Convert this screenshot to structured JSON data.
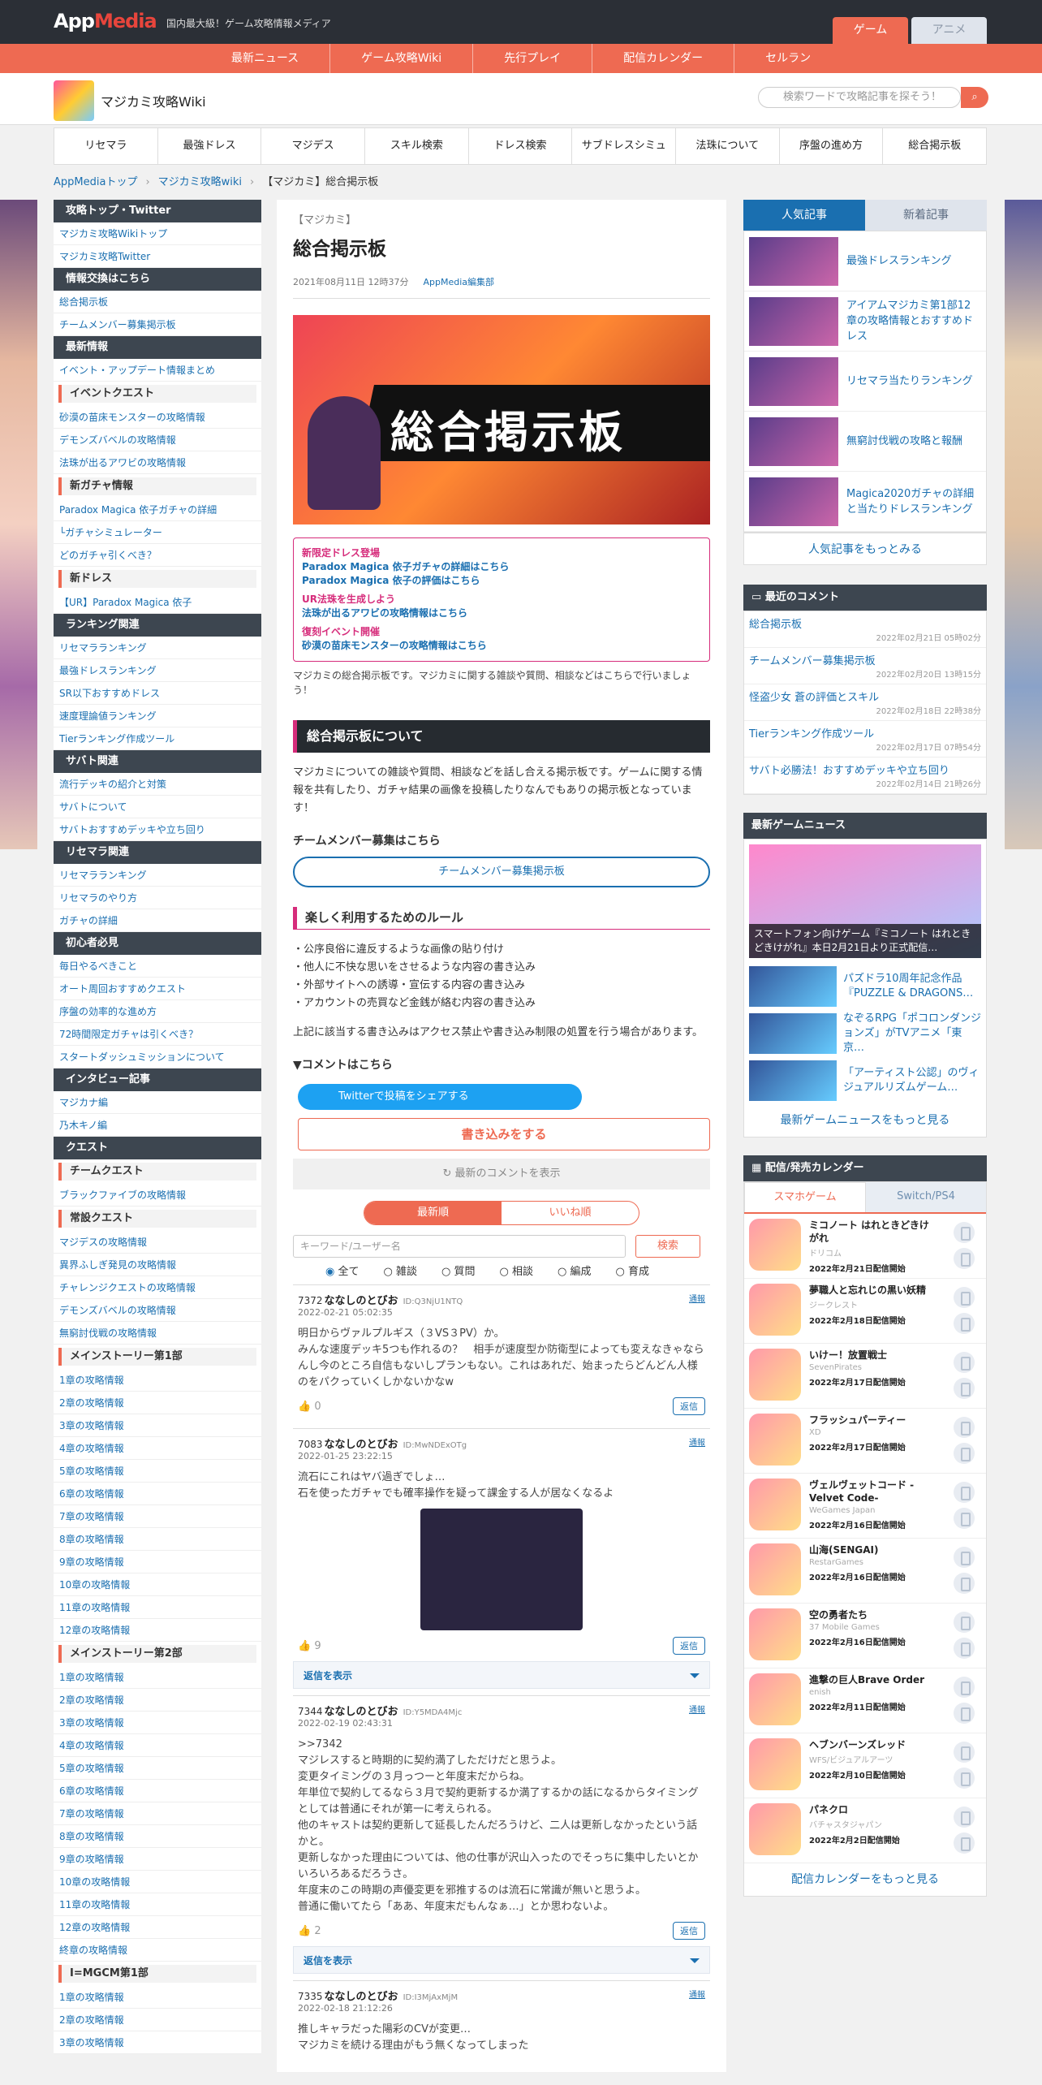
{
  "topbar": {
    "logo_a": "App",
    "logo_b": "Media",
    "tagline": "国内最大級！ゲーム攻略情報メディア",
    "tab_game": "ゲーム",
    "tab_anime": "アニメ"
  },
  "rednav": [
    "最新ニュース",
    "ゲーム攻略Wiki",
    "先行プレイ",
    "配信カレンダー",
    "セルラン"
  ],
  "site": {
    "name": "マジカミ攻略Wiki",
    "search_placeholder": "検索ワードで攻略記事を探そう！"
  },
  "menu": [
    "リセマラ",
    "最強ドレス",
    "マジデス",
    "スキル検索",
    "ドレス検索",
    "サブドレスシミュ",
    "法珠について",
    "序盤の進め方",
    "総合掲示板"
  ],
  "breadcrumb": [
    "AppMediaトップ",
    "マジカミ攻略wiki",
    "【マジカミ】総合掲示板"
  ],
  "sidebar": [
    {
      "type": "h",
      "t": "攻略トップ・Twitter"
    },
    {
      "type": "l",
      "t": "マジカミ攻略Wikiトップ"
    },
    {
      "type": "l",
      "t": "マジカミ攻略Twitter"
    },
    {
      "type": "h",
      "t": "情報交換はこちら"
    },
    {
      "type": "l",
      "t": "総合掲示板"
    },
    {
      "type": "l",
      "t": "チームメンバー募集掲示板"
    },
    {
      "type": "h",
      "t": "最新情報"
    },
    {
      "type": "l",
      "t": "イベント・アップデート情報まとめ"
    },
    {
      "type": "s",
      "t": "イベントクエスト"
    },
    {
      "type": "l",
      "t": "砂漠の苗床モンスターの攻略情報"
    },
    {
      "type": "l",
      "t": "デモンズバベルの攻略情報"
    },
    {
      "type": "l",
      "t": "法珠が出るアワビの攻略情報"
    },
    {
      "type": "s",
      "t": "新ガチャ情報"
    },
    {
      "type": "l",
      "t": "Paradox Magica 依子ガチャの詳細"
    },
    {
      "type": "l",
      "t": "└ガチャシミュレーター"
    },
    {
      "type": "l",
      "t": "どのガチャ引くべき？"
    },
    {
      "type": "s",
      "t": "新ドレス"
    },
    {
      "type": "l",
      "t": "【UR】Paradox Magica 依子"
    },
    {
      "type": "h",
      "t": "ランキング関連"
    },
    {
      "type": "l",
      "t": "リセマラランキング"
    },
    {
      "type": "l",
      "t": "最強ドレスランキング"
    },
    {
      "type": "l",
      "t": "SR以下おすすめドレス"
    },
    {
      "type": "l",
      "t": "速度理論値ランキング"
    },
    {
      "type": "l",
      "t": "Tierランキング作成ツール"
    },
    {
      "type": "h",
      "t": "サバト関連"
    },
    {
      "type": "l",
      "t": "流行デッキの紹介と対策"
    },
    {
      "type": "l",
      "t": "サバトについて"
    },
    {
      "type": "l",
      "t": "サバトおすすめデッキや立ち回り"
    },
    {
      "type": "h",
      "t": "リセマラ関連"
    },
    {
      "type": "l",
      "t": "リセマラランキング"
    },
    {
      "type": "l",
      "t": "リセマラのやり方"
    },
    {
      "type": "l",
      "t": "ガチャの詳細"
    },
    {
      "type": "h",
      "t": "初心者必見"
    },
    {
      "type": "l",
      "t": "毎日やるべきこと"
    },
    {
      "type": "l",
      "t": "オート周回おすすめクエスト"
    },
    {
      "type": "l",
      "t": "序盤の効率的な進め方"
    },
    {
      "type": "l",
      "t": "72時間限定ガチャは引くべき？"
    },
    {
      "type": "l",
      "t": "スタートダッシュミッションについて"
    },
    {
      "type": "h",
      "t": "インタビュー記事"
    },
    {
      "type": "l",
      "t": "マジカナ編"
    },
    {
      "type": "l",
      "t": "乃木キノ編"
    },
    {
      "type": "h",
      "t": "クエスト"
    },
    {
      "type": "s",
      "t": "チームクエスト"
    },
    {
      "type": "l",
      "t": "ブラックファイブの攻略情報"
    },
    {
      "type": "s",
      "t": "常設クエスト"
    },
    {
      "type": "l",
      "t": "マジデスの攻略情報"
    },
    {
      "type": "l",
      "t": "異界ふしぎ発見の攻略情報"
    },
    {
      "type": "l",
      "t": "チャレンジクエストの攻略情報"
    },
    {
      "type": "l",
      "t": "デモンズバベルの攻略情報"
    },
    {
      "type": "l",
      "t": "無窮討伐戦の攻略情報"
    },
    {
      "type": "s",
      "t": "メインストーリー第1部"
    },
    {
      "type": "l",
      "t": "1章の攻略情報"
    },
    {
      "type": "l",
      "t": "2章の攻略情報"
    },
    {
      "type": "l",
      "t": "3章の攻略情報"
    },
    {
      "type": "l",
      "t": "4章の攻略情報"
    },
    {
      "type": "l",
      "t": "5章の攻略情報"
    },
    {
      "type": "l",
      "t": "6章の攻略情報"
    },
    {
      "type": "l",
      "t": "7章の攻略情報"
    },
    {
      "type": "l",
      "t": "8章の攻略情報"
    },
    {
      "type": "l",
      "t": "9章の攻略情報"
    },
    {
      "type": "l",
      "t": "10章の攻略情報"
    },
    {
      "type": "l",
      "t": "11章の攻略情報"
    },
    {
      "type": "l",
      "t": "12章の攻略情報"
    },
    {
      "type": "s",
      "t": "メインストーリー第2部"
    },
    {
      "type": "l",
      "t": "1章の攻略情報"
    },
    {
      "type": "l",
      "t": "2章の攻略情報"
    },
    {
      "type": "l",
      "t": "3章の攻略情報"
    },
    {
      "type": "l",
      "t": "4章の攻略情報"
    },
    {
      "type": "l",
      "t": "5章の攻略情報"
    },
    {
      "type": "l",
      "t": "6章の攻略情報"
    },
    {
      "type": "l",
      "t": "7章の攻略情報"
    },
    {
      "type": "l",
      "t": "8章の攻略情報"
    },
    {
      "type": "l",
      "t": "9章の攻略情報"
    },
    {
      "type": "l",
      "t": "10章の攻略情報"
    },
    {
      "type": "l",
      "t": "11章の攻略情報"
    },
    {
      "type": "l",
      "t": "12章の攻略情報"
    },
    {
      "type": "l",
      "t": "終章の攻略情報"
    },
    {
      "type": "s",
      "t": "I=MGCM第1部"
    },
    {
      "type": "l",
      "t": "1章の攻略情報"
    },
    {
      "type": "l",
      "t": "2章の攻略情報"
    },
    {
      "type": "l",
      "t": "3章の攻略情報"
    }
  ],
  "article": {
    "category": "【マジカミ】",
    "title": "総合掲示板",
    "date": "2021年08月11日 12時37分",
    "author": "AppMedia編集部",
    "hero_text": "総合掲示板",
    "box": [
      {
        "k": "h",
        "t": "新限定ドレス登場"
      },
      {
        "k": "l",
        "t": "Paradox Magica 依子ガチャの詳細はこちら"
      },
      {
        "k": "l",
        "t": "Paradox Magica 依子の評価はこちら"
      },
      {
        "k": "h",
        "t": "UR法珠を生成しよう"
      },
      {
        "k": "l",
        "t": "法珠が出るアワビの攻略情報はこちら"
      },
      {
        "k": "h",
        "t": "復刻イベント開催"
      },
      {
        "k": "l",
        "t": "砂漠の苗床モンスターの攻略情報はこちら"
      }
    ],
    "intro": "マジカミの総合掲示板です。マジカミに関する雑談や質問、相談などはこちらで行いましょう！",
    "h2": "総合掲示板について",
    "about": "マジカミについての雑談や質問、相談などを話し合える掲示板です。ゲームに関する情報を共有したり、ガチャ結果の画像を投稿したりなんでもありの掲示板となっています！",
    "team_heading": "チームメンバー募集はこちら",
    "team_button": "チームメンバー募集掲示板",
    "rules_heading": "楽しく利用するためのルール",
    "rules": [
      "・公序良俗に違反するような画像の貼り付け",
      "・他人に不快な思いをさせるような内容の書き込み",
      "・外部サイトへの誘導・宣伝する内容の書き込み",
      "・アカウントの売買など金銭が絡む内容の書き込み"
    ],
    "rules_note": "上記に該当する書き込みはアクセス禁止や書き込み制限の処置を行う場合があります。",
    "comment_heading": "▼コメントはこちら",
    "twitter": "Twitterで投稿をシェアする",
    "post": "書き込みをする",
    "latest": "最新のコメントを表示",
    "sort": [
      "最新順",
      "いいね順"
    ],
    "kw_placeholder": "キーワード/ユーザー名",
    "kw_btn": "検索",
    "radios": [
      "全て",
      "雑談",
      "質問",
      "相談",
      "編成",
      "育成"
    ],
    "report": "通報",
    "reply": "返信",
    "showreply": "返信を表示",
    "comments": [
      {
        "no": "7372",
        "name": "ななしのとびお",
        "id": "ID:Q3NjU1NTQ",
        "date": "2022-02-21 05:02:35",
        "text": "明日からヴァルプルギス（３VS３PV）か。\nみんな速度デッキ5つも作れるの？　相手が速度型か防衛型によっても変えなきゃならんし今のところ自信もないしプランもない。これはあれだ、始まったらどんどん人様のをパクっていくしかないかなw",
        "likes": "0"
      },
      {
        "no": "7083",
        "name": "ななしのとびお",
        "id": "ID:MwNDExOTg",
        "date": "2022-01-25 23:22:15",
        "text": "流石にこれはヤバ過ぎでしょ…\n石を使ったガチャでも確率操作を疑って課金する人が居なくなるよ",
        "likes": "9"
      },
      {
        "no": "7344",
        "name": "ななしのとびお",
        "id": "ID:Y5MDA4Mjc",
        "date": "2022-02-19 02:43:31",
        "text": ">>7342\nマジレスすると時期的に契約満了しただけだと思うよ。\n変更タイミングの３月っつーと年度末だからね。\n年単位で契約してるなら３月で契約更新するか満了するかの話になるからタイミングとしては普通にそれが第一に考えられる。\n他のキャストは契約更新して延長したんだろうけど、二人は更新しなかったという話かと。\n更新しなかった理由については、他の仕事が沢山入ったのでそっちに集中したいとかいろいろあるだろうさ。\n年度末のこの時期の声優変更を邪推するのは流石に常識が無いと思うよ。\n普通に働いてたら「ああ、年度末だもんなぁ…」とか思わないよ。",
        "likes": "2"
      },
      {
        "no": "7335",
        "name": "ななしのとびお",
        "id": "ID:I3MjAxMjM",
        "date": "2022-02-18 21:12:26",
        "text": "推しキャラだった陽彩のCVが変更…\nマジカミを続ける理由がもう無くなってしまった",
        "likes": ""
      }
    ]
  },
  "right": {
    "tabs": [
      "人気記事",
      "新着記事"
    ],
    "popular": [
      "最強ドレスランキング",
      "アイアムマジカミ第1部12章の攻略情報とおすすめドレス",
      "リセマラ当たりランキング",
      "無窮討伐戦の攻略と報酬",
      "Magica2020ガチャの詳細と当たりドレスランキング"
    ],
    "popular_more": "人気記事をもっとみる",
    "recent_heading": "最近のコメント",
    "recent": [
      {
        "t": "総合掲示板",
        "d": "2022年02月21日 05時02分"
      },
      {
        "t": "チームメンバー募集掲示板",
        "d": "2022年02月20日 13時15分"
      },
      {
        "t": "怪盗少女 蒼の評価とスキル",
        "d": "2022年02月18日 22時38分"
      },
      {
        "t": "Tierランキング作成ツール",
        "d": "2022年02月17日 07時54分"
      },
      {
        "t": "サバト必勝法！おすすめデッキや立ち回り",
        "d": "2022年02月14日 21時26分"
      }
    ],
    "news_heading": "最新ゲームニュース",
    "news_big": "スマートフォン向けゲーム『ミコノート はれときどきけがれ』本日2月21日より正式配信…",
    "news": [
      "パズドラ10周年記念作品『PUZZLE & DRAGONS…",
      "なぞるRPG「ポコロンダンジョンズ」がTVアニメ「東京…",
      "「アーティスト公認」のヴィジュアルリズムゲーム…"
    ],
    "news_more": "最新ゲームニュースをもっと見る",
    "cal_heading": "配信/発売カレンダー",
    "cal_tabs": [
      "スマホゲーム",
      "Switch/PS4"
    ],
    "cal": [
      {
        "n": "ミコノート はれときどきけがれ",
        "p": "ドリコム",
        "d": "2022年2月21日配信開始"
      },
      {
        "n": "夢職人と忘れじの黒い妖精",
        "p": "ジークレスト",
        "d": "2022年2月18日配信開始"
      },
      {
        "n": "いけー！放置戦士",
        "p": "SevenPirates",
        "d": "2022年2月17日配信開始"
      },
      {
        "n": "フラッシュパーティー",
        "p": "XD",
        "d": "2022年2月17日配信開始"
      },
      {
        "n": "ヴェルヴェットコード -Velvet Code-",
        "p": "WeGames Japan",
        "d": "2022年2月16日配信開始"
      },
      {
        "n": "山海(SENGAI)",
        "p": "RestarGames",
        "d": "2022年2月16日配信開始"
      },
      {
        "n": "空の勇者たち",
        "p": "37 Mobile Games",
        "d": "2022年2月16日配信開始"
      },
      {
        "n": "進撃の巨人Brave Order",
        "p": "enish",
        "d": "2022年2月11日配信開始"
      },
      {
        "n": "ヘブンバーンズレッド",
        "p": "WFS/ビジュアルアーツ",
        "d": "2022年2月10日配信開始"
      },
      {
        "n": "パネクロ",
        "p": "バチャスタジャパン",
        "d": "2022年2月2日配信開始"
      }
    ],
    "cal_more": "配信カレンダーをもっと見る"
  }
}
